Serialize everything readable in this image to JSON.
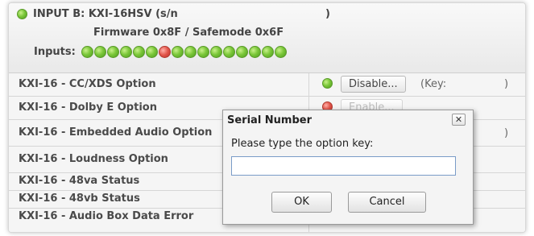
{
  "header": {
    "input_label": "INPUT B:",
    "model": "KXI-16HSV (s/n",
    "close_paren": ")",
    "firmware": "Firmware 0x8F / Safemode 0x6F",
    "inputs_label": "Inputs:",
    "input_leds": [
      "green",
      "green",
      "green",
      "green",
      "green",
      "green",
      "red",
      "green",
      "green",
      "green",
      "green",
      "green",
      "green",
      "green",
      "green",
      "green"
    ]
  },
  "rows": [
    {
      "name": "KXI-16 - CC/XDS Option",
      "led": "green",
      "button": "Disable...",
      "key_label": "(Key:",
      "key_close": ")"
    },
    {
      "name": "KXI-16 - Dolby E Option",
      "led": "red",
      "button": "Enable..."
    },
    {
      "name": "KXI-16 - Embedded Audio Option",
      "led": "green",
      "key_close": ")"
    },
    {
      "name": "KXI-16 - Loudness Option"
    },
    {
      "name": "KXI-16 - 48va Status",
      "led": "green"
    },
    {
      "name": "KXI-16 - 48vb Status"
    },
    {
      "name": "KXI-16 - Audio Box Data Error",
      "led": "red"
    }
  ],
  "dialog": {
    "title": "Serial Number",
    "close_glyph": "✕",
    "prompt": "Please type the option key:",
    "input_value": "",
    "ok_label": "OK",
    "cancel_label": "Cancel"
  }
}
